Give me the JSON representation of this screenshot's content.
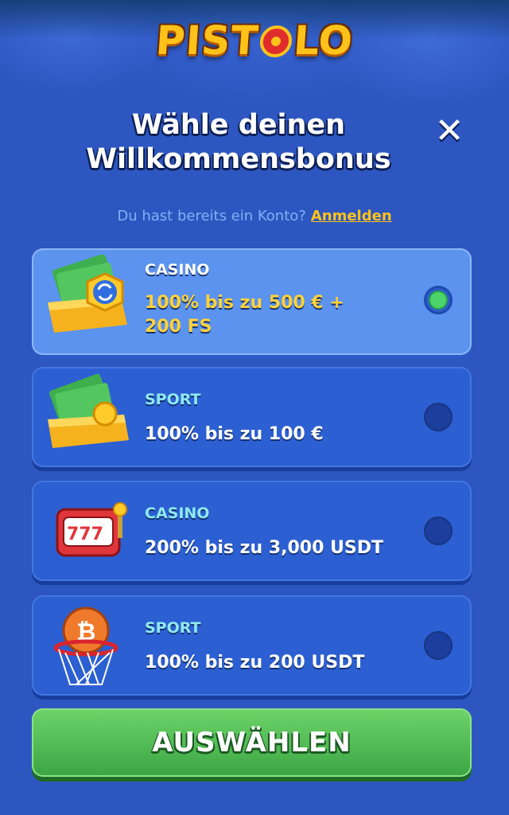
{
  "brand": {
    "logo_text": "PISTOLO",
    "logo_left": "PIST",
    "logo_right": "LO"
  },
  "header": {
    "title_line1": "Wähle deinen",
    "title_line2": "Willkommensbonus",
    "close_label": "✕"
  },
  "login": {
    "prompt": "Du hast bereits ein Konto?",
    "link": "Anmelden"
  },
  "bonuses": [
    {
      "category": "CASINO",
      "offer_line1": "100% bis zu 500 € +",
      "offer_line2": "200 FS",
      "icon": "cash-box-crypto-icon",
      "selected": true
    },
    {
      "category": "SPORT",
      "offer_line1": "100% bis zu 100 €",
      "icon": "cash-box-coin-icon",
      "selected": false
    },
    {
      "category": "CASINO",
      "offer_line1": "200% bis zu 3,000 USDT",
      "icon": "slot-machine-icon",
      "selected": false
    },
    {
      "category": "SPORT",
      "offer_line1": "100% bis zu 200 USDT",
      "icon": "bitcoin-basketball-icon",
      "selected": false
    }
  ],
  "cta": {
    "label": "AUSWÄHLEN"
  },
  "colors": {
    "background": "#2d56c0",
    "accent": "#ffc21a",
    "selected_card": "#5b93ee",
    "radio_on": "#4cd36a",
    "cta": "#4cb84f"
  }
}
